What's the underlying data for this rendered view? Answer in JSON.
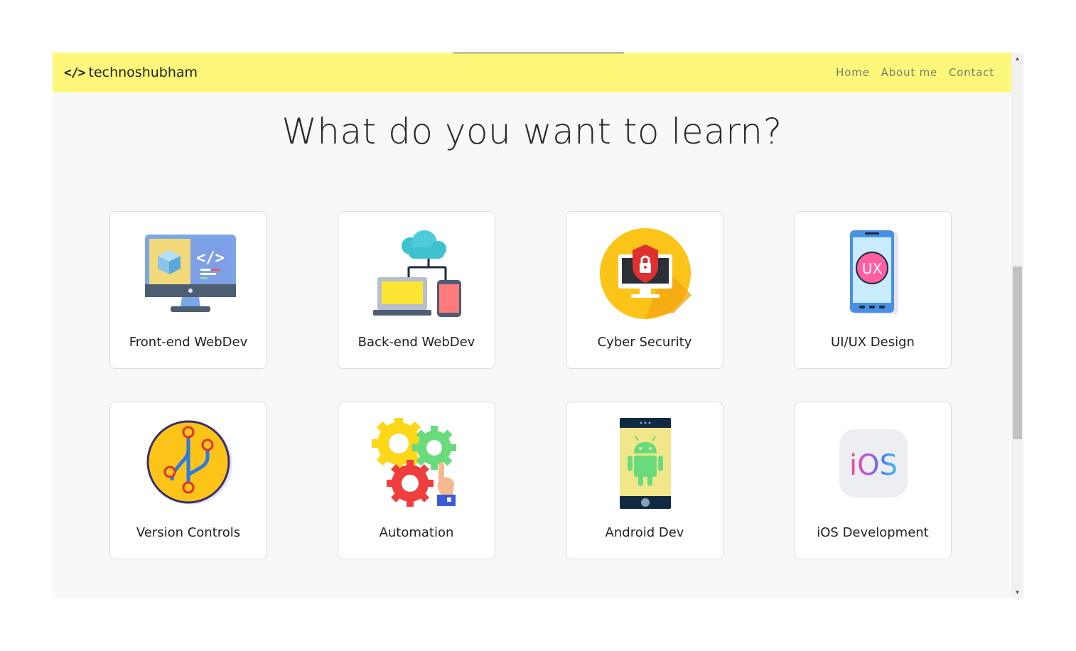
{
  "navbar": {
    "brand_icon": "</>",
    "brand": "technoshubham",
    "links": [
      {
        "label": "Home"
      },
      {
        "label": "About me"
      },
      {
        "label": "Contact"
      }
    ]
  },
  "heading": "What do you want to learn?",
  "cards": [
    {
      "label": "Front-end WebDev",
      "icon": "monitor-code-icon"
    },
    {
      "label": "Back-end WebDev",
      "icon": "cloud-devices-icon"
    },
    {
      "label": "Cyber Security",
      "icon": "security-lock-icon"
    },
    {
      "label": "UI/UX Design",
      "icon": "phone-ux-icon"
    },
    {
      "label": "Version Controls",
      "icon": "git-branch-icon"
    },
    {
      "label": "Automation",
      "icon": "gears-icon"
    },
    {
      "label": "Android Dev",
      "icon": "android-phone-icon"
    },
    {
      "label": "iOS Development",
      "icon": "ios-icon",
      "icon_text": "iOS"
    }
  ],
  "colors": {
    "navbar_bg": "#fdf87a",
    "page_bg": "#f8f8f8",
    "card_bg": "#ffffff"
  }
}
